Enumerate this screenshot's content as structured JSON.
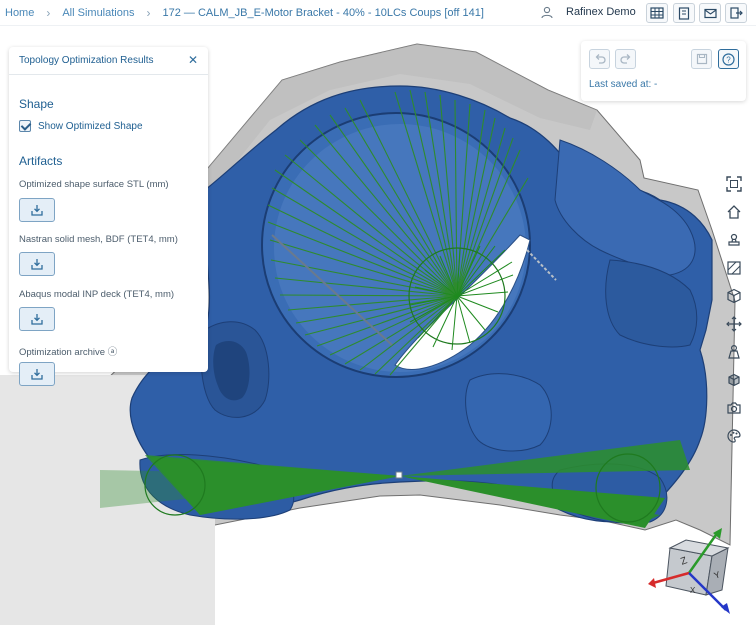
{
  "breadcrumb": {
    "home": "Home",
    "simulations": "All Simulations",
    "current": "172 — CALM_JB_E-Motor Bracket - 40% - 10LCs Coups [off 141]"
  },
  "user": {
    "name": "Rafinex Demo"
  },
  "results_panel": {
    "title": "Topology Optimization Results",
    "shape_heading": "Shape",
    "show_optimized_label": "Show Optimized Shape",
    "show_optimized_checked": true,
    "artifacts_heading": "Artifacts",
    "artifacts": [
      {
        "label": "Optimized shape surface STL (mm)"
      },
      {
        "label": "Nastran solid mesh, BDF (TET4, mm)"
      },
      {
        "label": "Abaqus modal INP deck (TET4, mm)"
      },
      {
        "label": "Optimization archive ⓐ"
      }
    ]
  },
  "save_panel": {
    "last_saved": "Last saved at: -"
  },
  "view_cube": {
    "faces": [
      "Z",
      "Y",
      "X"
    ]
  },
  "colors": {
    "accent": "#1f5f91",
    "model": "#2d5fa6",
    "load_lines": "#2e8b2e"
  }
}
